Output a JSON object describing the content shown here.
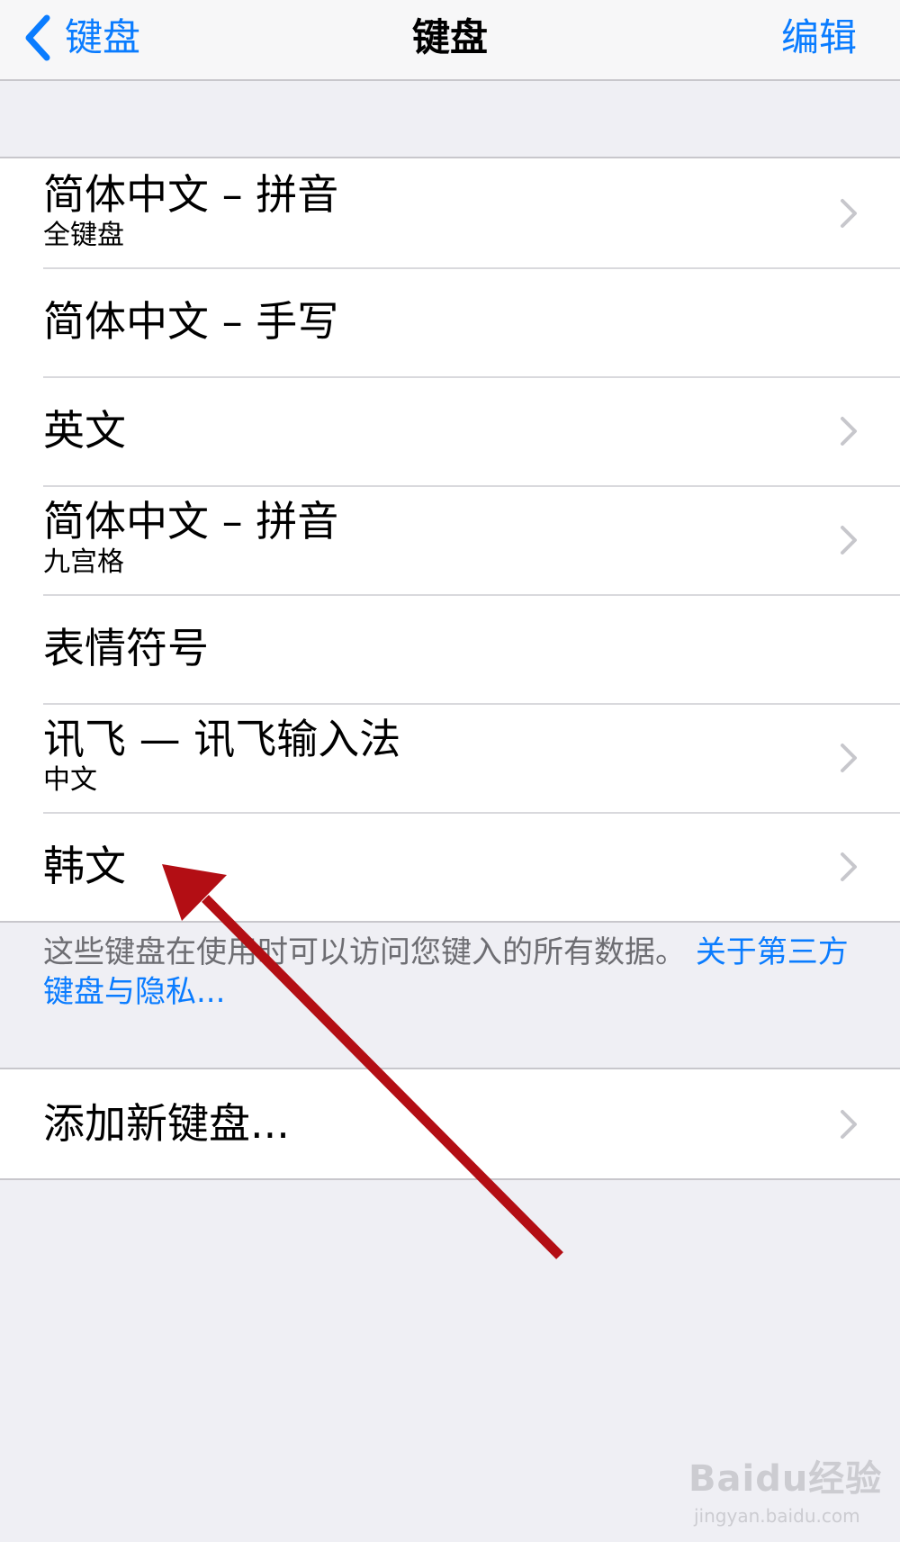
{
  "navbar": {
    "back_label": "键盘",
    "title": "键盘",
    "edit_label": "编辑"
  },
  "keyboards": [
    {
      "title": "简体中文 – 拼音",
      "subtitle": "全键盘",
      "chevron": true
    },
    {
      "title": "简体中文 – 手写",
      "subtitle": "",
      "chevron": false
    },
    {
      "title": "英文",
      "subtitle": "",
      "chevron": true
    },
    {
      "title": "简体中文 – 拼音",
      "subtitle": "九宫格",
      "chevron": true
    },
    {
      "title": "表情符号",
      "subtitle": "",
      "chevron": false
    },
    {
      "title": "讯飞 — 讯飞输入法",
      "subtitle": "中文",
      "chevron": true
    },
    {
      "title": "韩文",
      "subtitle": "",
      "chevron": true
    }
  ],
  "footnote": {
    "text": "这些键盘在使用时可以访问您键入的所有数据。",
    "link": "关于第三方键盘与隐私..."
  },
  "add_keyboard": {
    "label": "添加新键盘..."
  },
  "annotation": {
    "arrow_color": "#b30e14"
  },
  "watermark": {
    "logo": "Baidu经验",
    "url": "jingyan.baidu.com"
  },
  "colors": {
    "accent": "#0a7cff",
    "background": "#efeff4",
    "separator": "#c8c7cc"
  }
}
